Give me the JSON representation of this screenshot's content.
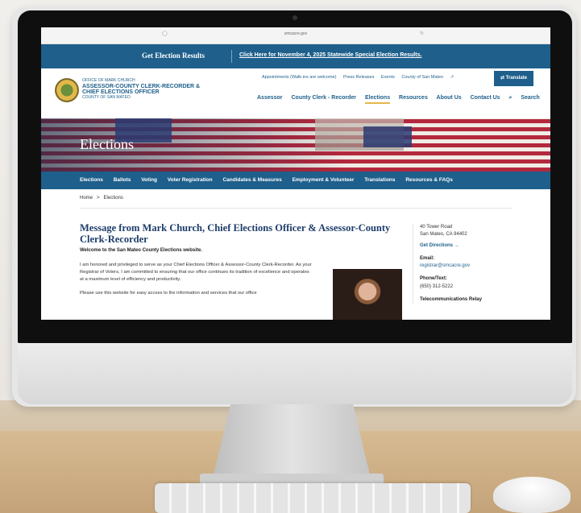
{
  "browser": {
    "url": "smcacre.gov"
  },
  "banner": {
    "label": "Get Election Results",
    "link": "Click Here for November 4, 2025 Statewide Special Election Results."
  },
  "office": {
    "line1": "OFFICE OF MARK CHURCH",
    "line2": "ASSESSOR-COUNTY CLERK-RECORDER &",
    "line3": "CHIEF ELECTIONS OFFICER",
    "line4": "COUNTY OF SAN MATEO"
  },
  "utility_nav": [
    "Appointments (Walk-ins are welcome)",
    "Press Releases",
    "Events",
    "County of San Mateo"
  ],
  "translate_label": "Translate",
  "main_nav": [
    "Assessor",
    "County Clerk - Recorder",
    "Elections",
    "Resources",
    "About Us",
    "Contact Us"
  ],
  "search_label": "Search",
  "hero_title": "Elections",
  "sub_nav": [
    "Elections",
    "Ballots",
    "Voting",
    "Voter Registration",
    "Candidates & Measures",
    "Employment & Volunteer",
    "Translations",
    "Resources & FAQs"
  ],
  "breadcrumb": {
    "home": "Home",
    "separator": ">",
    "current": "Elections"
  },
  "content": {
    "title": "Message from Mark Church, Chief Elections Officer & Assessor-County Clerk-Recorder",
    "welcome": "Welcome to the San Mateo County Elections website.",
    "p1": "I am honored and privileged to serve as your Chief Elections Officer & Assessor-County Clerk-Recorder. As your Registrar of Voters, I am committed to ensuring that our office continues its tradition of excellence and operates at a maximum level of efficiency and productivity.",
    "p2": "Please use this website for easy access to the information and services that our office"
  },
  "sidebar": {
    "addr1": "40 Tower Road",
    "addr2": "San Mateo, CA 94402",
    "directions": "Get Directions",
    "email_label": "Email:",
    "email": "registrar@smcacre.gov",
    "phone_label": "Phone/Text:",
    "phone": "(650) 312-5222",
    "relay": "Telecommunications Relay"
  }
}
